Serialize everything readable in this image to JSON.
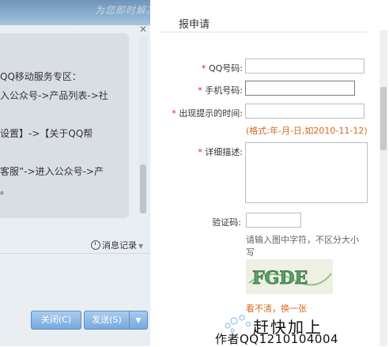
{
  "chat": {
    "header_watermark": "为您即时解决各类问题",
    "message_lines": [
      "QQ移动服务专区：",
      "入公众号->产品列表->社",
      "设置】->【关于QQ帮",
      "客服”->进入公众号->产",
      "。"
    ],
    "history_label": "消息记录",
    "close_button": "关闭(C)",
    "send_button": "发送(S)"
  },
  "form": {
    "title": "报申请",
    "fields": {
      "qq_label": "QQ号码:",
      "phone_label": "手机号码:",
      "time_label": "出现提示的时间:",
      "date_hint": "(格式:年-月-日,如2010-11-12)",
      "detail_label": "详细描述:",
      "captcha_label": "验证码:",
      "captcha_hint": "请输入图中字符，不区分大小写",
      "captcha_text": "FGDE",
      "refresh_link": "看不清，换一张"
    }
  },
  "watermark": {
    "main": "赶快加上",
    "sub": "作者QQ1210104004"
  }
}
